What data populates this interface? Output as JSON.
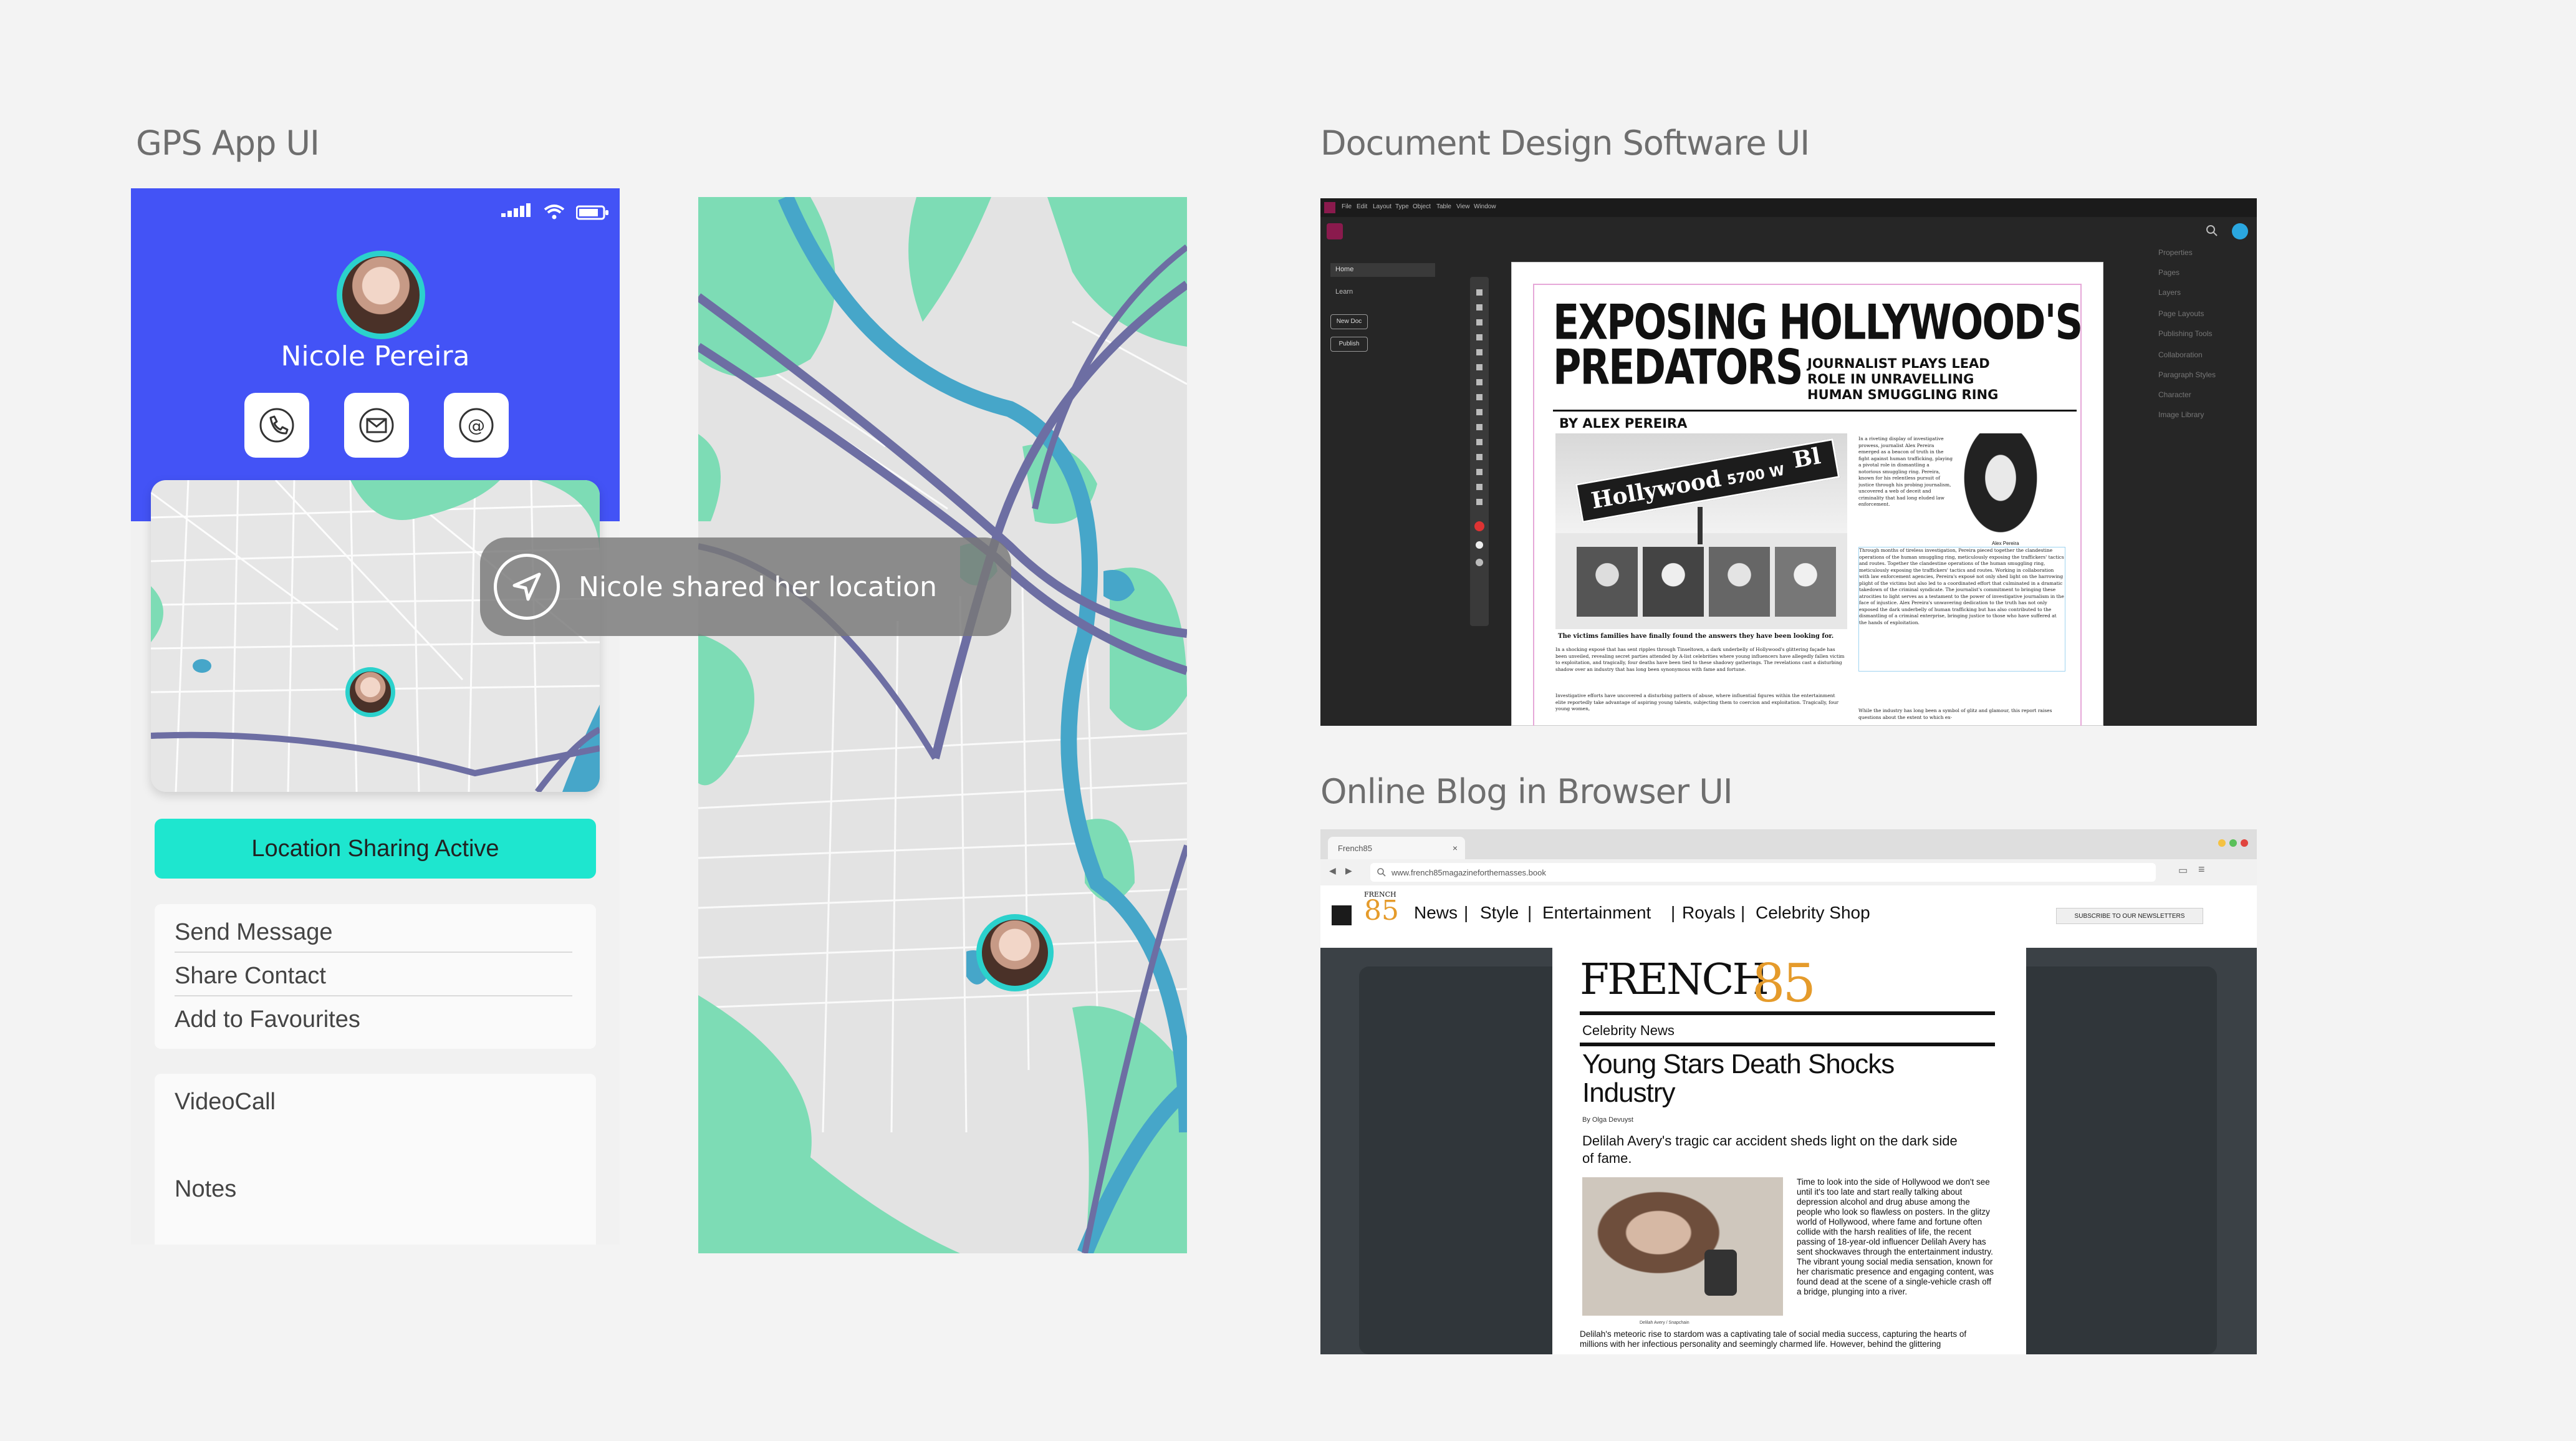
{
  "sections": {
    "gps": "GPS App UI",
    "doc": "Document Design Software UI",
    "blog": "Online Blog in Browser UI"
  },
  "gps": {
    "contact_name": "Nicole Pereira",
    "share_status": "Location Sharing Active",
    "menu1": [
      "Send Message",
      "Share Contact",
      "Add to Favourites"
    ],
    "menu2": [
      "VideoCall",
      "Notes"
    ],
    "toast": "Nicole shared her location",
    "colors": {
      "header": "#4353f6",
      "accent": "#1ee6cf",
      "ring": "#2bd1cc",
      "park": "#7ddcb5",
      "water": "#46a6c9",
      "road": "#6d6ea3"
    },
    "icons": [
      "phone-icon",
      "envelope-icon",
      "at-sign-icon",
      "navigation-arrow-icon"
    ]
  },
  "doc": {
    "menus": [
      "File",
      "Edit",
      "Layout",
      "Type",
      "Object",
      "Table",
      "View",
      "Window"
    ],
    "left_nav": [
      "Home",
      "Learn"
    ],
    "left_buttons": [
      "New Doc",
      "Publish"
    ],
    "right_panels": [
      "Properties",
      "Pages",
      "Layers",
      "Page Layouts",
      "Publishing Tools",
      "Collaboration",
      "Paragraph Styles",
      "Character",
      "Image Library"
    ],
    "headline1": "EXPOSING HOLLYWOOD'S",
    "headline2": "PREDATORS",
    "deck": [
      "JOURNALIST PLAYS LEAD",
      "ROLE IN UNRAVELLING",
      "HUMAN SMUGGLING RING"
    ],
    "byline": "BY ALEX PEREIRA",
    "sign_text": "Hollywood",
    "sign_number": "5700 W",
    "sign_suffix": "Bl",
    "portrait_caption": "Alex Pereira",
    "photo_caption": "The victims families have finally found the answers they have been looking for.",
    "col_right_1": "In a riveting display of investigative prowess, journalist Alex Pereira emerged as a beacon of truth in the fight against human trafficking, playing a pivotal role in dismantling a notorious smuggling ring. Pereira, known for his relentless pursuit of justice through his probing journalism, uncovered a web of deceit and criminality that had long eluded law enforcement.",
    "col_right_2": "Through months of tireless investigation, Pereira pieced together the clandestine operations of the human smuggling ring, meticulously exposing the traffickers' tactics and routes. Together the clandestine operations of the human smuggling ring, meticulously exposing the traffickers' tactics and routes. Working in collaboration with law enforcement agencies, Pereira's exposé not only shed light on the harrowing plight of the victims but also led to a coordinated effort that culminated in a dramatic takedown of the criminal syndicate. The journalist's commitment to bringing these atrocities to light serves as a testament to the power of investigative journalism in the face of injustice. Alex Pereira's unwavering dedication to the truth has not only exposed the dark underbelly of human trafficking but has also contributed to the dismantling of a criminal enterprise, bringing justice to those who have suffered at the hands of exploitation.",
    "col_left": "In a shocking exposé that has sent ripples through Tinseltown, a dark underbelly of Hollywood's glittering façade has been unveiled, revealing secret parties attended by A-list celebrities where young influencers have allegedly fallen victim to exploitation, and tragically, four deaths have been tied to these shadowy gatherings. The revelations cast a disturbing shadow over an industry that has long been synonymous with fame and fortune.",
    "col_left_2": "Investigative efforts have uncovered a disturbing pattern of abuse, where influential figures within the entertainment elite reportedly take advantage of aspiring young talents, subjecting them to coercion and exploitation. Tragically, four young women,",
    "col_bottom_right": "While the industry has long been a symbol of glitz and glamour, this report raises questions about the extent to which ex-"
  },
  "blog": {
    "tab_title": "French85",
    "url": "www.french85magazineforthemasses.book",
    "nav_logo_top": "FRENCH",
    "nav_logo_num": "85",
    "nav_links": [
      "News",
      "Style",
      "Entertainment",
      "Royals",
      "Celebrity Shop"
    ],
    "newsletter": "SUBSCRIBE TO OUR NEWSLETTERS",
    "masthead_word": "FRENCH",
    "masthead_num": "85",
    "category": "Celebrity News",
    "title_line1": "Young Stars Death Shocks",
    "title_line2": "Industry",
    "byline": "By Olga Devuyst",
    "subhead": "Delilah Avery's tragic car accident sheds light on the dark side of fame.",
    "photo_caption": "Delilah Avery / Snapchain",
    "body_right": "Time to look into the side of Hollywood we don't see until it's too late and start really talking about depression alcohol and drug abuse among the people who look so flawless on posters. In the glitzy world of Hollywood, where fame and fortune often collide with the harsh realities of life, the recent passing of 18-year-old influencer Delilah Avery has sent shockwaves through the entertainment industry. The vibrant young social media sensation, known for her charismatic presence and engaging content, was found dead at the scene of a single-vehicle crash off a bridge, plunging into a river.",
    "body_bottom": "Delilah's meteoric rise to stardom was a captivating tale of social media success, capturing the hearts of millions with her infectious personality and seemingly charmed life. However, behind the glittering",
    "colors": {
      "brand": "#e59b2b"
    }
  }
}
